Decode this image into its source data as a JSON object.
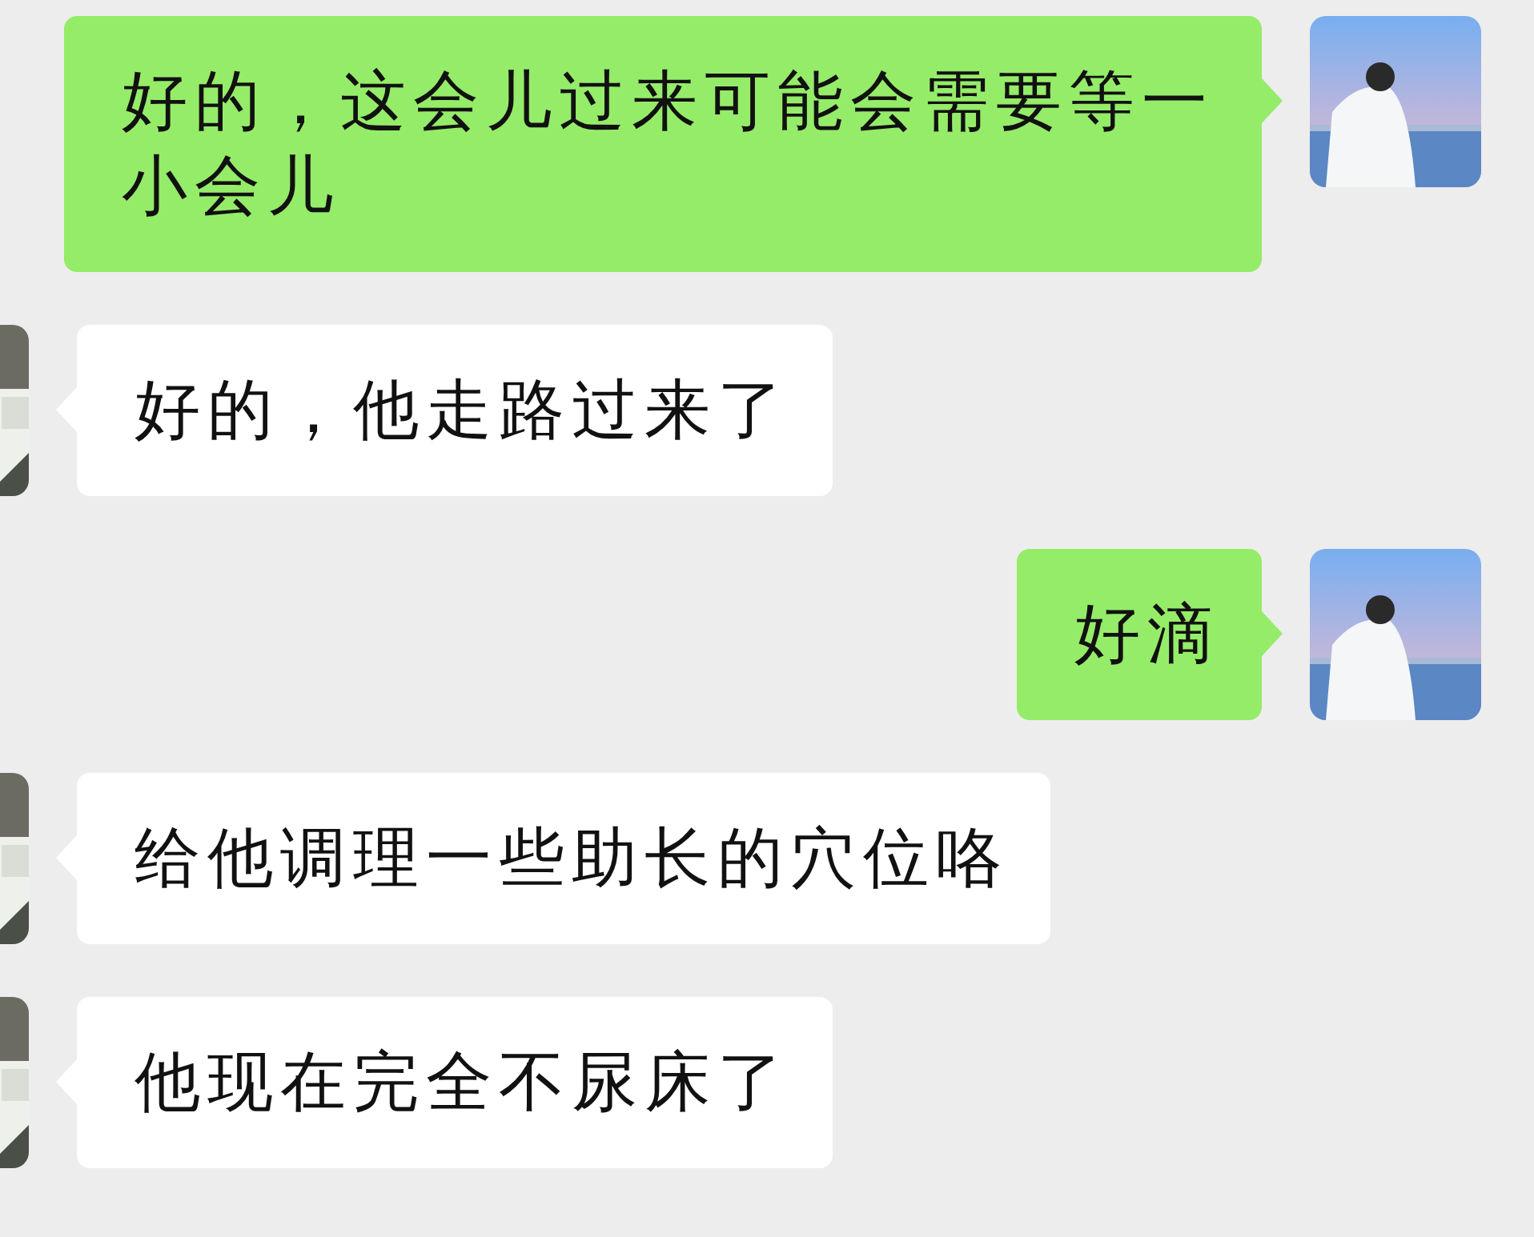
{
  "messages": [
    {
      "kind": "sent",
      "text": "好的，这会儿过来可能会需要等一小会儿"
    },
    {
      "kind": "received",
      "text": "好的，他走路过来了"
    },
    {
      "kind": "sent",
      "text": "好滴"
    },
    {
      "kind": "received",
      "text": "给他调理一些助长的穴位咯"
    },
    {
      "kind": "received",
      "text": "他现在完全不尿床了"
    }
  ]
}
